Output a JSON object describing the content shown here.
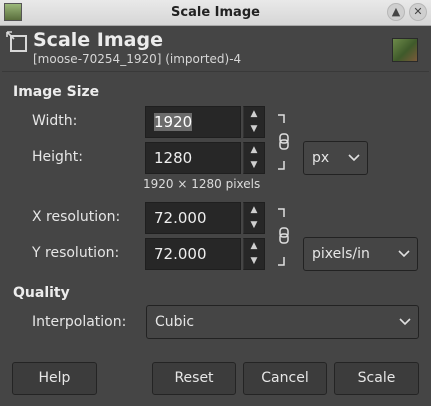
{
  "window": {
    "title": "Scale Image",
    "maximize_icon": "up-arrow",
    "close_icon": "x"
  },
  "header": {
    "title": "Scale Image",
    "subtitle": "[moose-70254_1920] (imported)-4"
  },
  "image_size": {
    "section_label": "Image Size",
    "width_label": "Width:",
    "width_value": "1920",
    "height_label": "Height:",
    "height_value": "1280",
    "size_unit": "px",
    "pixels_note": "1920 × 1280 pixels",
    "xres_label": "X resolution:",
    "xres_value": "72.000",
    "yres_label": "Y resolution:",
    "yres_value": "72.000",
    "res_unit": "pixels/in"
  },
  "quality": {
    "section_label": "Quality",
    "interp_label": "Interpolation:",
    "interp_value": "Cubic"
  },
  "buttons": {
    "help": "Help",
    "reset": "Reset",
    "cancel": "Cancel",
    "scale": "Scale"
  },
  "colors": {
    "background": "#454545",
    "entry_bg": "#272727",
    "selection": "#6b6b6b"
  }
}
